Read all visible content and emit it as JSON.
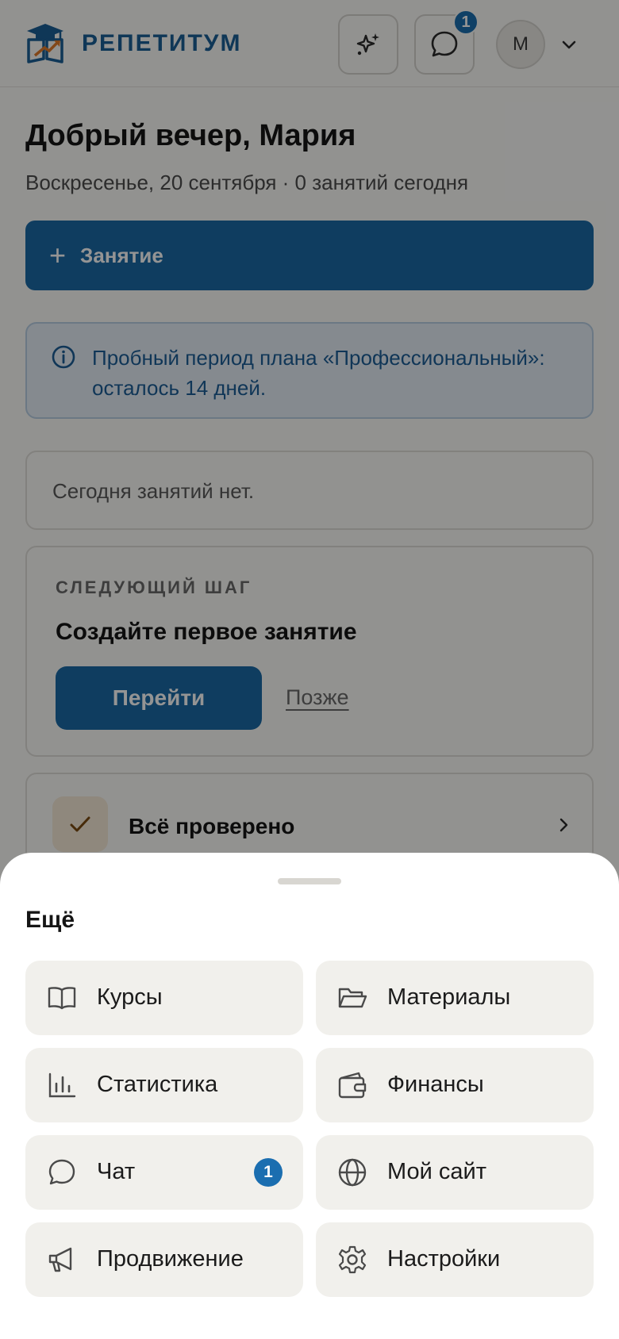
{
  "header": {
    "brand": "РЕПЕТИТУМ",
    "chat_badge": "1",
    "avatar_initial": "M"
  },
  "greeting": {
    "title": "Добрый вечер, Мария",
    "subtitle": "Воскресенье, 20 сентября · 0 занятий сегодня"
  },
  "new_lesson_button": "Занятие",
  "trial_notice": "Пробный период плана «Профессиональный»: осталось 14 дней.",
  "today_empty": "Сегодня занятий нет.",
  "next_step": {
    "kicker": "СЛЕДУЮЩИЙ ШАГ",
    "title": "Создайте первое занятие",
    "go_button": "Перейти",
    "later_link": "Позже"
  },
  "all_checked": "Всё проверено",
  "sheet": {
    "title": "Ещё",
    "items": [
      {
        "label": "Курсы",
        "icon": "book-icon"
      },
      {
        "label": "Материалы",
        "icon": "folder-icon"
      },
      {
        "label": "Статистика",
        "icon": "bar-chart-icon"
      },
      {
        "label": "Финансы",
        "icon": "wallet-icon"
      },
      {
        "label": "Чат",
        "icon": "chat-icon",
        "badge": "1"
      },
      {
        "label": "Мой сайт",
        "icon": "globe-icon"
      },
      {
        "label": "Продвижение",
        "icon": "megaphone-icon"
      },
      {
        "label": "Настройки",
        "icon": "gear-icon"
      }
    ]
  },
  "colors": {
    "accent": "#1a6aa6",
    "brand": "#1b5f96",
    "logo_orange": "#e07a2a",
    "badge": "#1b6eb0"
  }
}
